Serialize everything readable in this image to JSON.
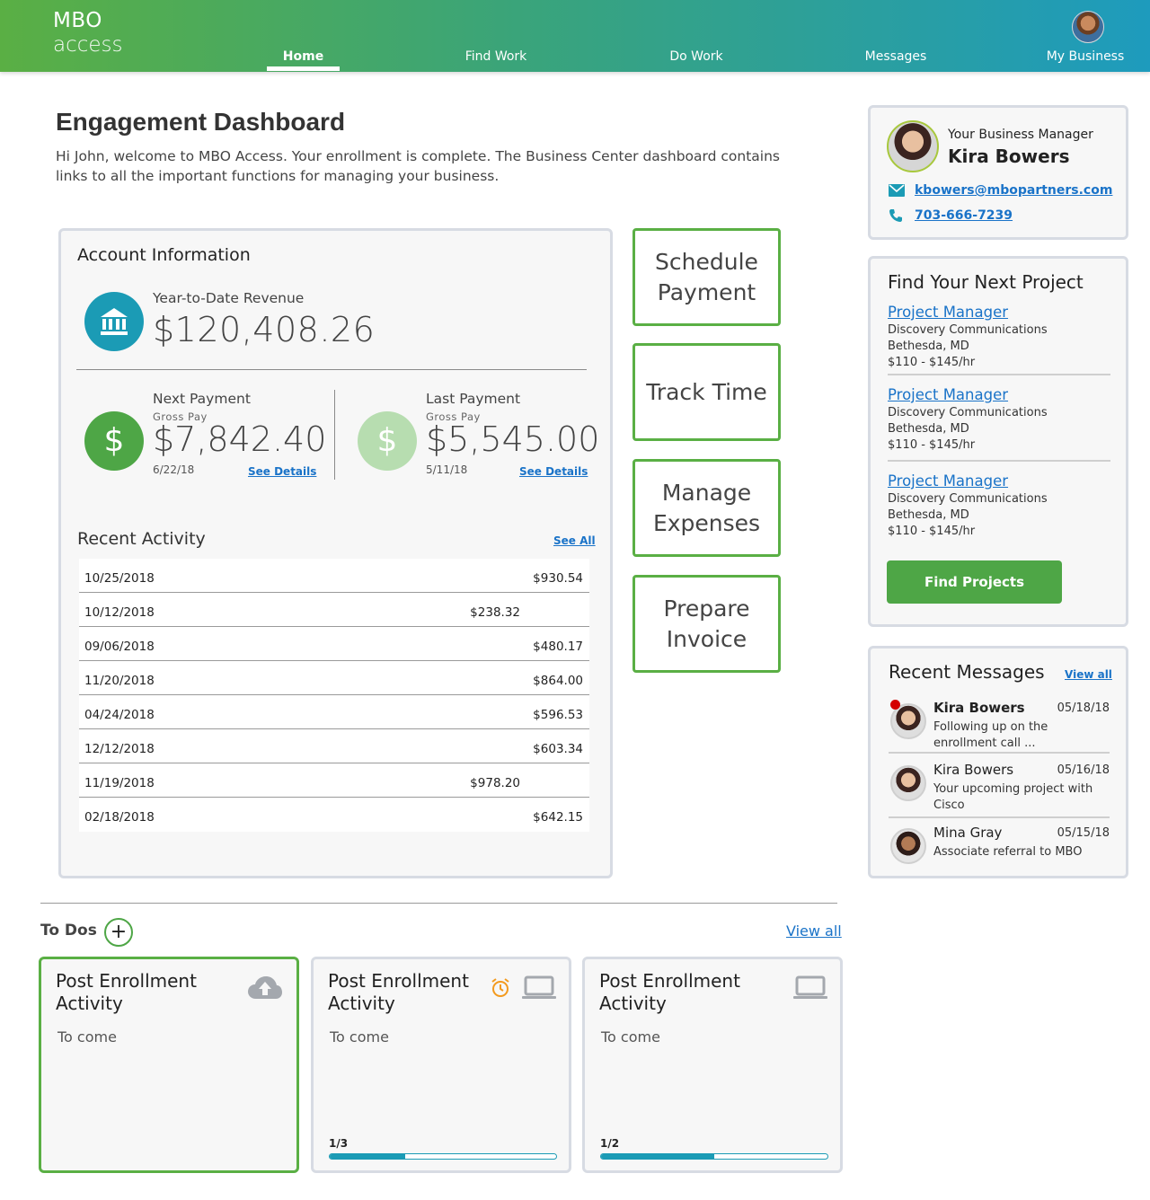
{
  "app": {
    "logo_line1": "MBO",
    "logo_line2": "access"
  },
  "nav": {
    "items": [
      {
        "label": "Home",
        "active": true
      },
      {
        "label": "Find Work",
        "active": false
      },
      {
        "label": "Do Work",
        "active": false
      },
      {
        "label": "Messages",
        "active": false
      },
      {
        "label": "My Business",
        "active": false
      }
    ]
  },
  "page": {
    "title": "Engagement Dashboard",
    "intro": "Hi John, welcome to MBO Access. Your enrollment is complete. The Business Center dashboard contains links to all the important functions for managing your business."
  },
  "account": {
    "title": "Account Information",
    "ytd_label": "Year-to-Date Revenue",
    "ytd_value": "$120,408.26",
    "next": {
      "label": "Next Payment",
      "sub": "Gross Pay",
      "value": "$7,842.40",
      "date": "6/22/18",
      "link": "See Details"
    },
    "last": {
      "label": "Last Payment",
      "sub": "Gross Pay",
      "value": "$5,545.00",
      "date": "5/11/18",
      "link": "See Details"
    },
    "recent_title": "Recent Activity",
    "recent_link": "See All",
    "activity": [
      {
        "date": "10/25/2018",
        "amount": "$930.54",
        "indent": false
      },
      {
        "date": "10/12/2018",
        "amount": "$238.32",
        "indent": true
      },
      {
        "date": "09/06/2018",
        "amount": "$480.17",
        "indent": false
      },
      {
        "date": "11/20/2018",
        "amount": "$864.00",
        "indent": false
      },
      {
        "date": "04/24/2018",
        "amount": "$596.53",
        "indent": false
      },
      {
        "date": "12/12/2018",
        "amount": "$603.34",
        "indent": false
      },
      {
        "date": "11/19/2018",
        "amount": "$978.20",
        "indent": true
      },
      {
        "date": "02/18/2018",
        "amount": "$642.15",
        "indent": false
      }
    ]
  },
  "actions": [
    {
      "label": "Schedule Payment"
    },
    {
      "label": "Track Time"
    },
    {
      "label": "Manage Expenses"
    },
    {
      "label": "Prepare Invoice"
    }
  ],
  "manager": {
    "label": "Your Business Manager",
    "name": "Kira Bowers",
    "email": "kbowers@mbopartners.com",
    "phone": "703-666-7239"
  },
  "projects": {
    "title": "Find Your Next Project",
    "items": [
      {
        "role": "Project Manager",
        "company": "Discovery Communications",
        "location": "Bethesda, MD",
        "rate": "$110 - $145/hr"
      },
      {
        "role": "Project Manager",
        "company": "Discovery Communications",
        "location": "Bethesda, MD",
        "rate": "$110 - $145/hr"
      },
      {
        "role": "Project Manager",
        "company": "Discovery Communications",
        "location": "Bethesda, MD",
        "rate": "$110 - $145/hr"
      }
    ],
    "button": "Find Projects"
  },
  "messages": {
    "title": "Recent Messages",
    "link": "View all",
    "items": [
      {
        "name": "Kira Bowers",
        "date": "05/18/18",
        "text": "Following up on the enrollment call ...",
        "unread": true
      },
      {
        "name": "Kira Bowers",
        "date": "05/16/18",
        "text": "Your upcoming project with Cisco",
        "unread": false
      },
      {
        "name": "Mina Gray",
        "date": "05/15/18",
        "text": "Associate referral to MBO",
        "unread": false
      }
    ]
  },
  "todos": {
    "title": "To Dos",
    "add_label": "+",
    "link": "View all",
    "cards": [
      {
        "title": "Post Enrollment Activity",
        "body": "To come",
        "progress_label": "",
        "progress": null,
        "icons": [
          "cloud-upload-icon"
        ]
      },
      {
        "title": "Post Enrollment Activity",
        "body": "To come",
        "progress_label": "1/3",
        "progress": 0.3333,
        "icons": [
          "alarm-clock-icon",
          "laptop-icon"
        ]
      },
      {
        "title": "Post Enrollment Activity",
        "body": "To come",
        "progress_label": "1/2",
        "progress": 0.5,
        "icons": [
          "laptop-icon"
        ]
      }
    ]
  },
  "colors": {
    "brand_green": "#5aaf44",
    "brand_teal": "#1b9bb5",
    "link_blue": "#1a73c8",
    "light_green": "#b7ddb0",
    "unread_red": "#d40000",
    "alarm_orange": "#f39a1e"
  }
}
